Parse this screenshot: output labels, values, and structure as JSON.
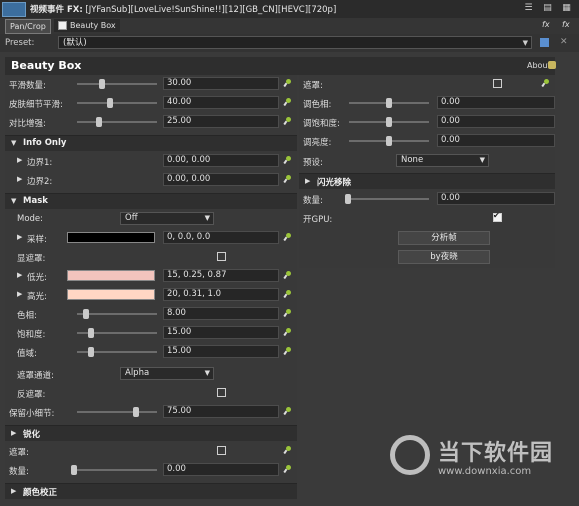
{
  "titlebar": {
    "title": "视频事件 FX:",
    "clip": "[JYFanSub][LoveLive!SunShine!!][12][GB_CN][HEVC][720p]"
  },
  "tabs": [
    {
      "label": "Pan/Crop"
    },
    {
      "label": "Beauty Box"
    }
  ],
  "preset": {
    "label": "Preset:",
    "value": "(默认)"
  },
  "plugin": {
    "title": "Beauty Box",
    "about": "About"
  },
  "left": {
    "rows_top": [
      {
        "label": "平滑数量:",
        "value": "30.00",
        "pos": 0.3
      },
      {
        "label": "皮肤细节平滑:",
        "value": "40.00",
        "pos": 0.4
      },
      {
        "label": "对比增强:",
        "value": "25.00",
        "pos": 0.25
      }
    ],
    "info_only": {
      "title": "Info Only",
      "rows": [
        {
          "label": "边界1:",
          "value": "0.00, 0.00"
        },
        {
          "label": "边界2:",
          "value": "0.00, 0.00"
        }
      ]
    },
    "mask": {
      "title": "Mask",
      "mode_label": "Mode:",
      "mode_value": "Off",
      "sample_label": "采样:",
      "sample_value": "0, 0.0, 0.0",
      "sample_color": "#000000",
      "show_mask_label": "显遮罩:",
      "low_label": "低光:",
      "low_value": "15, 0.25, 0.87",
      "low_color": "#f2c4bd",
      "high_label": "高光:",
      "high_value": "20, 0.31, 1.0",
      "high_color": "#ffd6c4",
      "hue_label": "色相:",
      "hue_value": "8.00",
      "hue_pos": 0.08,
      "sat_label": "饱和度:",
      "sat_value": "15.00",
      "sat_pos": 0.15,
      "range_label": "值域:",
      "range_value": "15.00",
      "range_pos": 0.15,
      "channel_label": "遮罩通道:",
      "channel_value": "Alpha",
      "invert_label": "反遮罩:",
      "detail_label": "保留小细节:",
      "detail_value": "75.00",
      "detail_pos": 0.75
    },
    "sharpen": {
      "title": "锐化",
      "mask_label": "遮罩:",
      "amount_label": "数量:",
      "amount_value": "0.00",
      "amount_pos": 0.0
    },
    "color_correct": {
      "title": "颜色校正"
    }
  },
  "right": {
    "mask_label": "遮罩:",
    "rows": [
      {
        "label": "调色相:",
        "value": "0.00",
        "pos": 0.5
      },
      {
        "label": "调饱和度:",
        "value": "0.00",
        "pos": 0.5
      },
      {
        "label": "调亮度:",
        "value": "0.00",
        "pos": 0.5
      }
    ],
    "preset_label": "预设:",
    "preset_value": "None",
    "flash": {
      "title": "闪光移除",
      "amount_label": "数量:",
      "amount_value": "0.00",
      "amount_pos": 0.0
    },
    "gpu_label": "开GPU:",
    "analyze_button": "分析帧",
    "by_button": "by夜晓"
  },
  "watermark": {
    "text": "当下软件园",
    "url": "www.downxia.com"
  }
}
